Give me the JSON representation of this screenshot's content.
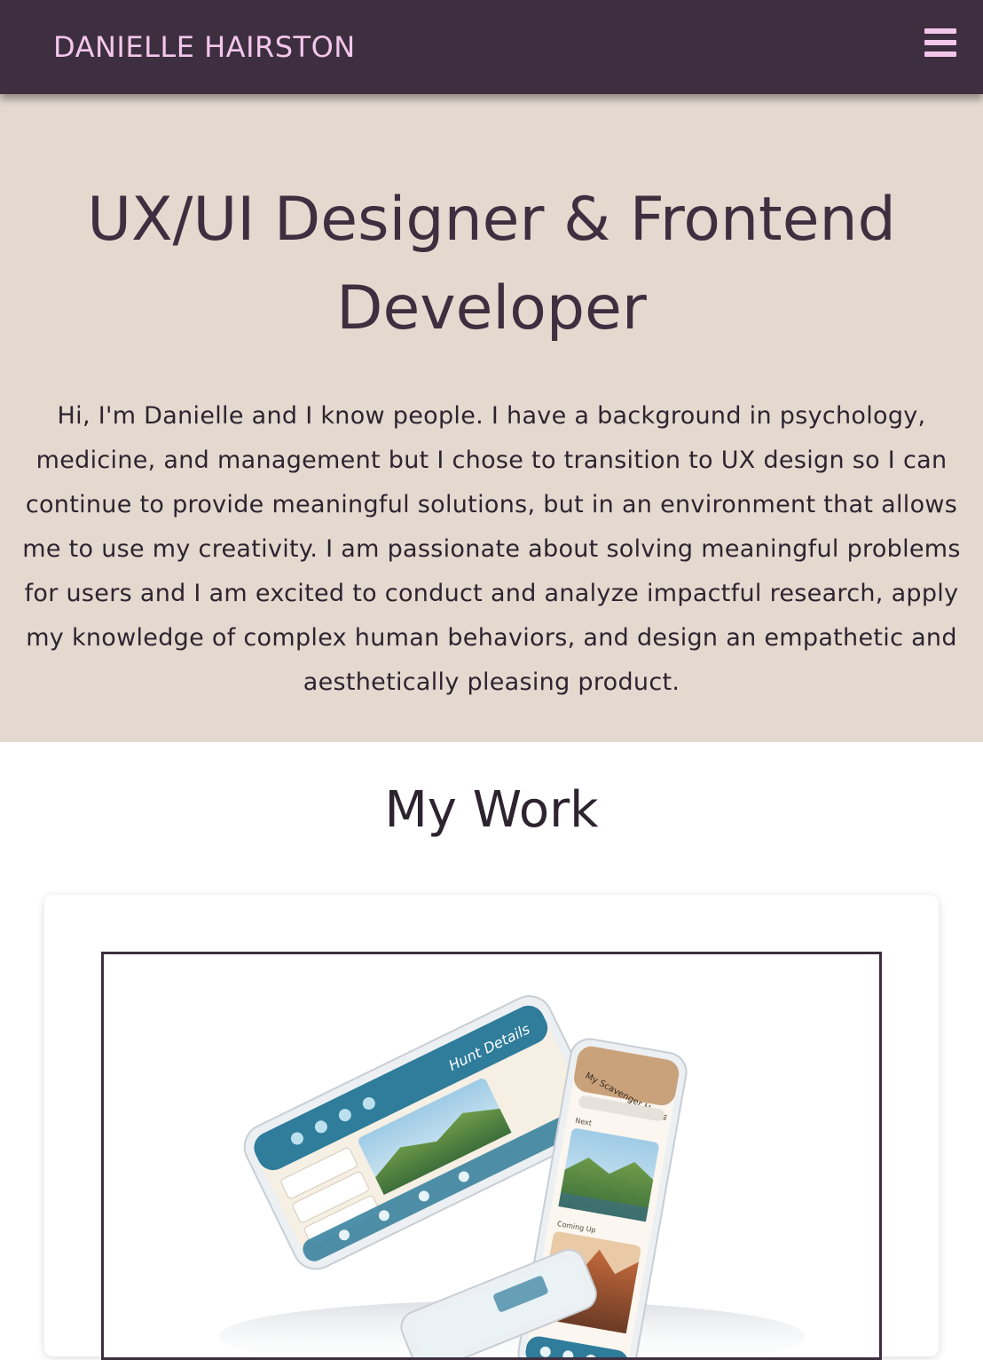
{
  "header": {
    "brand": "DANIELLE HAIRSTON",
    "menu_icon": "hamburger-menu-icon",
    "colors": {
      "bar": "#3d2f3f",
      "accent": "#f4c6ec"
    }
  },
  "hero": {
    "title": "UX/UI Designer & Frontend Developer",
    "intro": "Hi, I'm Danielle and I know people. I have a background in psychology, medicine, and management but I chose to transition to UX design so I can continue to provide meaningful solutions, but in an environment that allows me to use my creativity. I am passionate about solving meaningful problems for users and I am excited to conduct and analyze impactful research, apply my knowledge of complex human behaviors, and design an empathetic and aesthetically pleasing product.",
    "background": "#e3d9cf"
  },
  "work": {
    "heading": "My Work",
    "projects": [
      {
        "image": "scavenger-hunt-app-mockup",
        "screens": {
          "left_header": "Hunt Details",
          "right_header": "My Scavenger Hunts",
          "right_sections": [
            "Next",
            "Coming Up"
          ]
        }
      }
    ]
  }
}
